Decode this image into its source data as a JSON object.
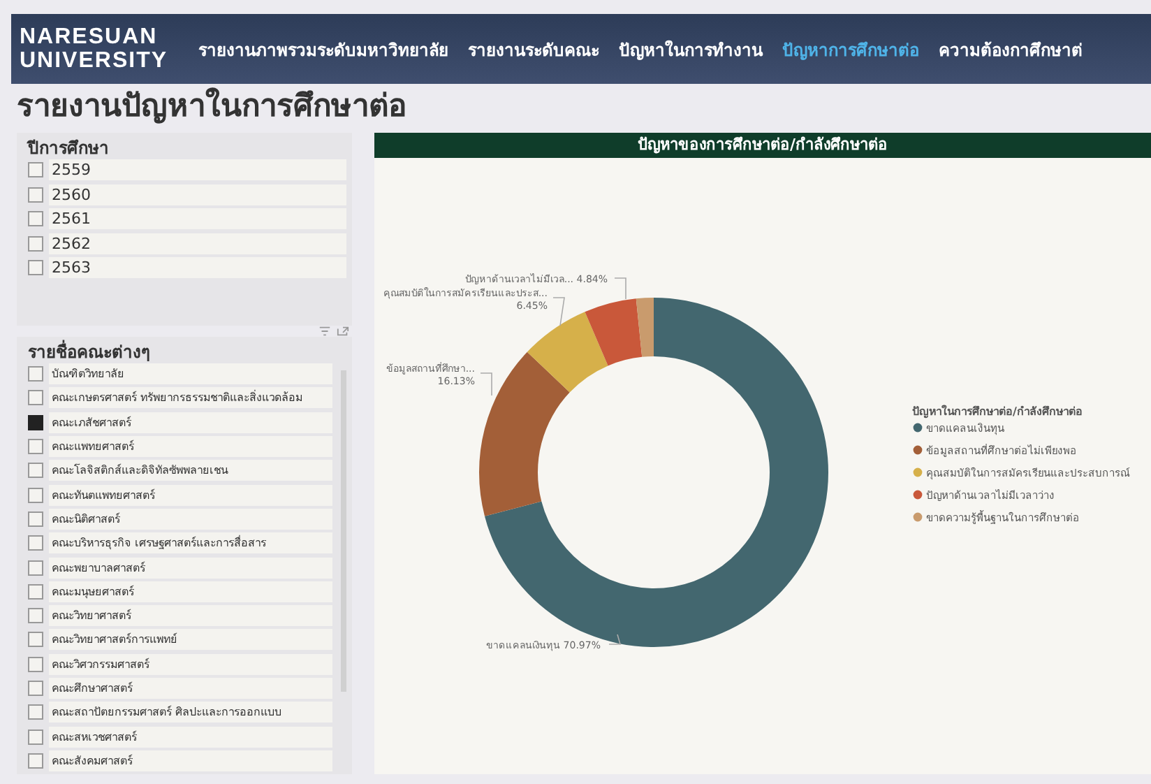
{
  "header": {
    "logo_lines": [
      "NARESUAN",
      "UNIVERSITY"
    ],
    "nav": [
      {
        "label": "รายงานภาพรวมระดับมหาวิทยาลัย",
        "selected": false
      },
      {
        "label": "รายงานระดับคณะ",
        "selected": false
      },
      {
        "label": "ปัญหาในการทำงาน",
        "selected": false
      },
      {
        "label": "ปัญหาการศึกษาต่อ",
        "selected": true
      },
      {
        "label": "ความต้องกาศึกษาต่",
        "selected": false
      }
    ]
  },
  "page_title": "รายงานปัญหาในการศึกษาต่อ",
  "year_filter": {
    "title": "ปีการศึกษา",
    "items": [
      {
        "label": "2559",
        "checked": false
      },
      {
        "label": "2560",
        "checked": false
      },
      {
        "label": "2561",
        "checked": false
      },
      {
        "label": "2562",
        "checked": false
      },
      {
        "label": "2563",
        "checked": false
      }
    ]
  },
  "faculty_filter": {
    "title": "รายชื่อคณะต่างๆ",
    "items": [
      {
        "label": "บัณฑิตวิทยาลัย",
        "checked": false
      },
      {
        "label": "คณะเกษตรศาสตร์ ทรัพยากรธรรมชาติและสิ่งแวดล้อม",
        "checked": false
      },
      {
        "label": "คณะเภสัชศาสตร์",
        "checked": true
      },
      {
        "label": "คณะแพทยศาสตร์",
        "checked": false
      },
      {
        "label": "คณะโลจิสติกส์และดิจิทัลซัพพลายเชน",
        "checked": false
      },
      {
        "label": "คณะทันตแพทยศาสตร์",
        "checked": false
      },
      {
        "label": "คณะนิติศาสตร์",
        "checked": false
      },
      {
        "label": "คณะบริหารธุรกิจ เศรษฐศาสตร์และการสื่อสาร",
        "checked": false
      },
      {
        "label": "คณะพยาบาลศาสตร์",
        "checked": false
      },
      {
        "label": "คณะมนุษยศาสตร์",
        "checked": false
      },
      {
        "label": "คณะวิทยาศาสตร์",
        "checked": false
      },
      {
        "label": "คณะวิทยาศาสตร์การแพทย์",
        "checked": false
      },
      {
        "label": "คณะวิศวกรรมศาสตร์",
        "checked": false
      },
      {
        "label": "คณะศึกษาศาสตร์",
        "checked": false
      },
      {
        "label": "คณะสถาปัตยกรรมศาสตร์ ศิลปะและการออกแบบ",
        "checked": false
      },
      {
        "label": "คณะสหเวชศาสตร์",
        "checked": false
      },
      {
        "label": "คณะสังคมศาสตร์",
        "checked": false
      }
    ]
  },
  "chart": {
    "title": "ปัญหาของการศึกษาต่อ/กำลังศึกษาต่อ",
    "callouts": [
      {
        "name": "ปัญหาด้านเวลาไม่มีเวล...",
        "value": "4.84%"
      },
      {
        "name": "คุณสมบัติในการสมัครเรียนและประส...",
        "value": "6.45%"
      },
      {
        "name": "ข้อมูลสถานที่ศึกษา...",
        "value": "16.13%"
      },
      {
        "name": "ขาดแคลนเงินทุน",
        "value": "70.97%"
      }
    ],
    "chart_data": {
      "type": "donut",
      "legend": "right",
      "categories": [
        "ขาดแคลนเงินทุน",
        "ข้อมูลสถานที่ศึกษาต่อไม่เพียงพอ",
        "คุณสมบัติในการสมัครเรียนและประสบการณ์",
        "ปัญหาด้านเวลาไม่มีเวลาว่าง",
        "ขาดความรู้พื้นฐานในการศึกษาต่อ"
      ],
      "series": [
        {
          "name": "ปัญหาในการศึกษาต่อ/กำลังศึกษาต่อ",
          "values": [
            70.97,
            16.13,
            6.45,
            4.84,
            1.61
          ]
        }
      ],
      "colors": [
        "#43676f",
        "#a35f38",
        "#d6b04a",
        "#c9583a",
        "#c99b6d"
      ]
    }
  }
}
